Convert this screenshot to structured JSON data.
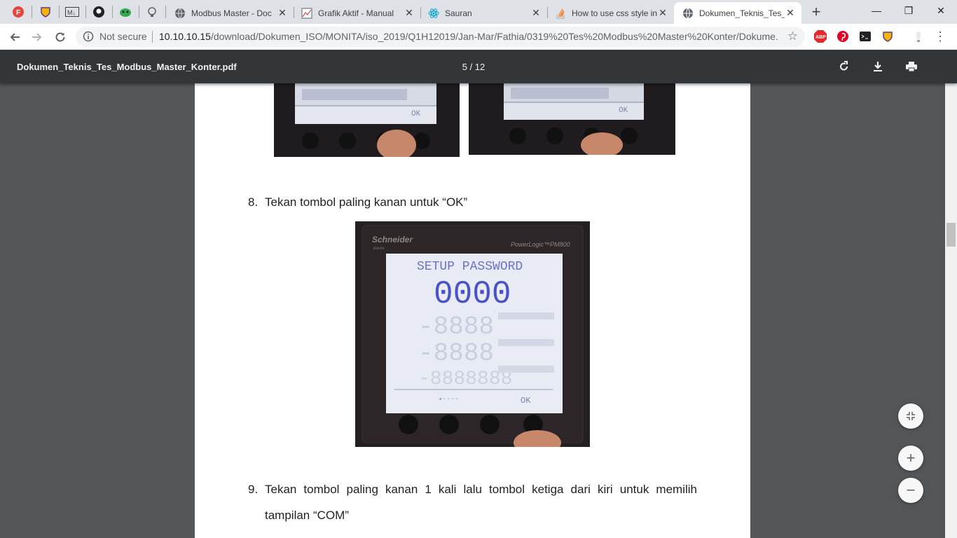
{
  "tabs": [
    {
      "title": "Modbus Master - Doc",
      "close": "✕"
    },
    {
      "title": "Grafik Aktif - Manual",
      "close": "✕"
    },
    {
      "title": "Sauran",
      "close": "✕"
    },
    {
      "title": "How to use css style in",
      "close": "✕"
    },
    {
      "title": "Dokumen_Teknis_Tes_",
      "close": "✕"
    }
  ],
  "pinned": [
    "firefox-f-icon",
    "shield-extension-icon",
    "markdown-icon",
    "github-icon",
    "green-monster-icon",
    "lighthouse-icon"
  ],
  "newtab_label": "+",
  "window": {
    "minimize": "—",
    "restore": "❐",
    "close": "✕"
  },
  "toolbar": {
    "security_label": "Not secure",
    "url_host": "10.10.10.15",
    "url_path": "/download/Dokumen_ISO/MONITA/iso_2019/Q1H12019/Jan-Mar/Fathia/0319%20Tes%20Modbus%20Master%20Konter/Dokume...",
    "star": "☆",
    "menu": "⋮"
  },
  "extensions": {
    "abp": "ABP"
  },
  "pdf": {
    "filename": "Dokumen_Teknis_Tes_Modbus_Master_Konter.pdf",
    "page_indicator": "5 / 12"
  },
  "document": {
    "step8_num": "8.",
    "step8_text": "Tekan tombol paling kanan untuk “OK”",
    "step9_num": "9.",
    "step9_line1": "Tekan tombol paling kanan 1 kali lalu tombol ketiga dari kiri untuk memilih",
    "step9_line2": "tampilan “COM”",
    "meter": {
      "brand": "Schneider",
      "brand_sub": "Electric",
      "model": "PowerLogic™PM800",
      "lcd_header": "SETUP  PASSWORD",
      "lcd_value": "0000",
      "lcd_ok": "OK"
    },
    "top_left_ok": "OK",
    "top_right_ok": "OK"
  },
  "zoom": {
    "fit": "fit-page-icon",
    "plus": "+",
    "minus": "−"
  },
  "colors": {
    "pdf_toolbar": "#323639",
    "viewer_bg": "#525659",
    "lcd_digit": "#4a52c8"
  }
}
